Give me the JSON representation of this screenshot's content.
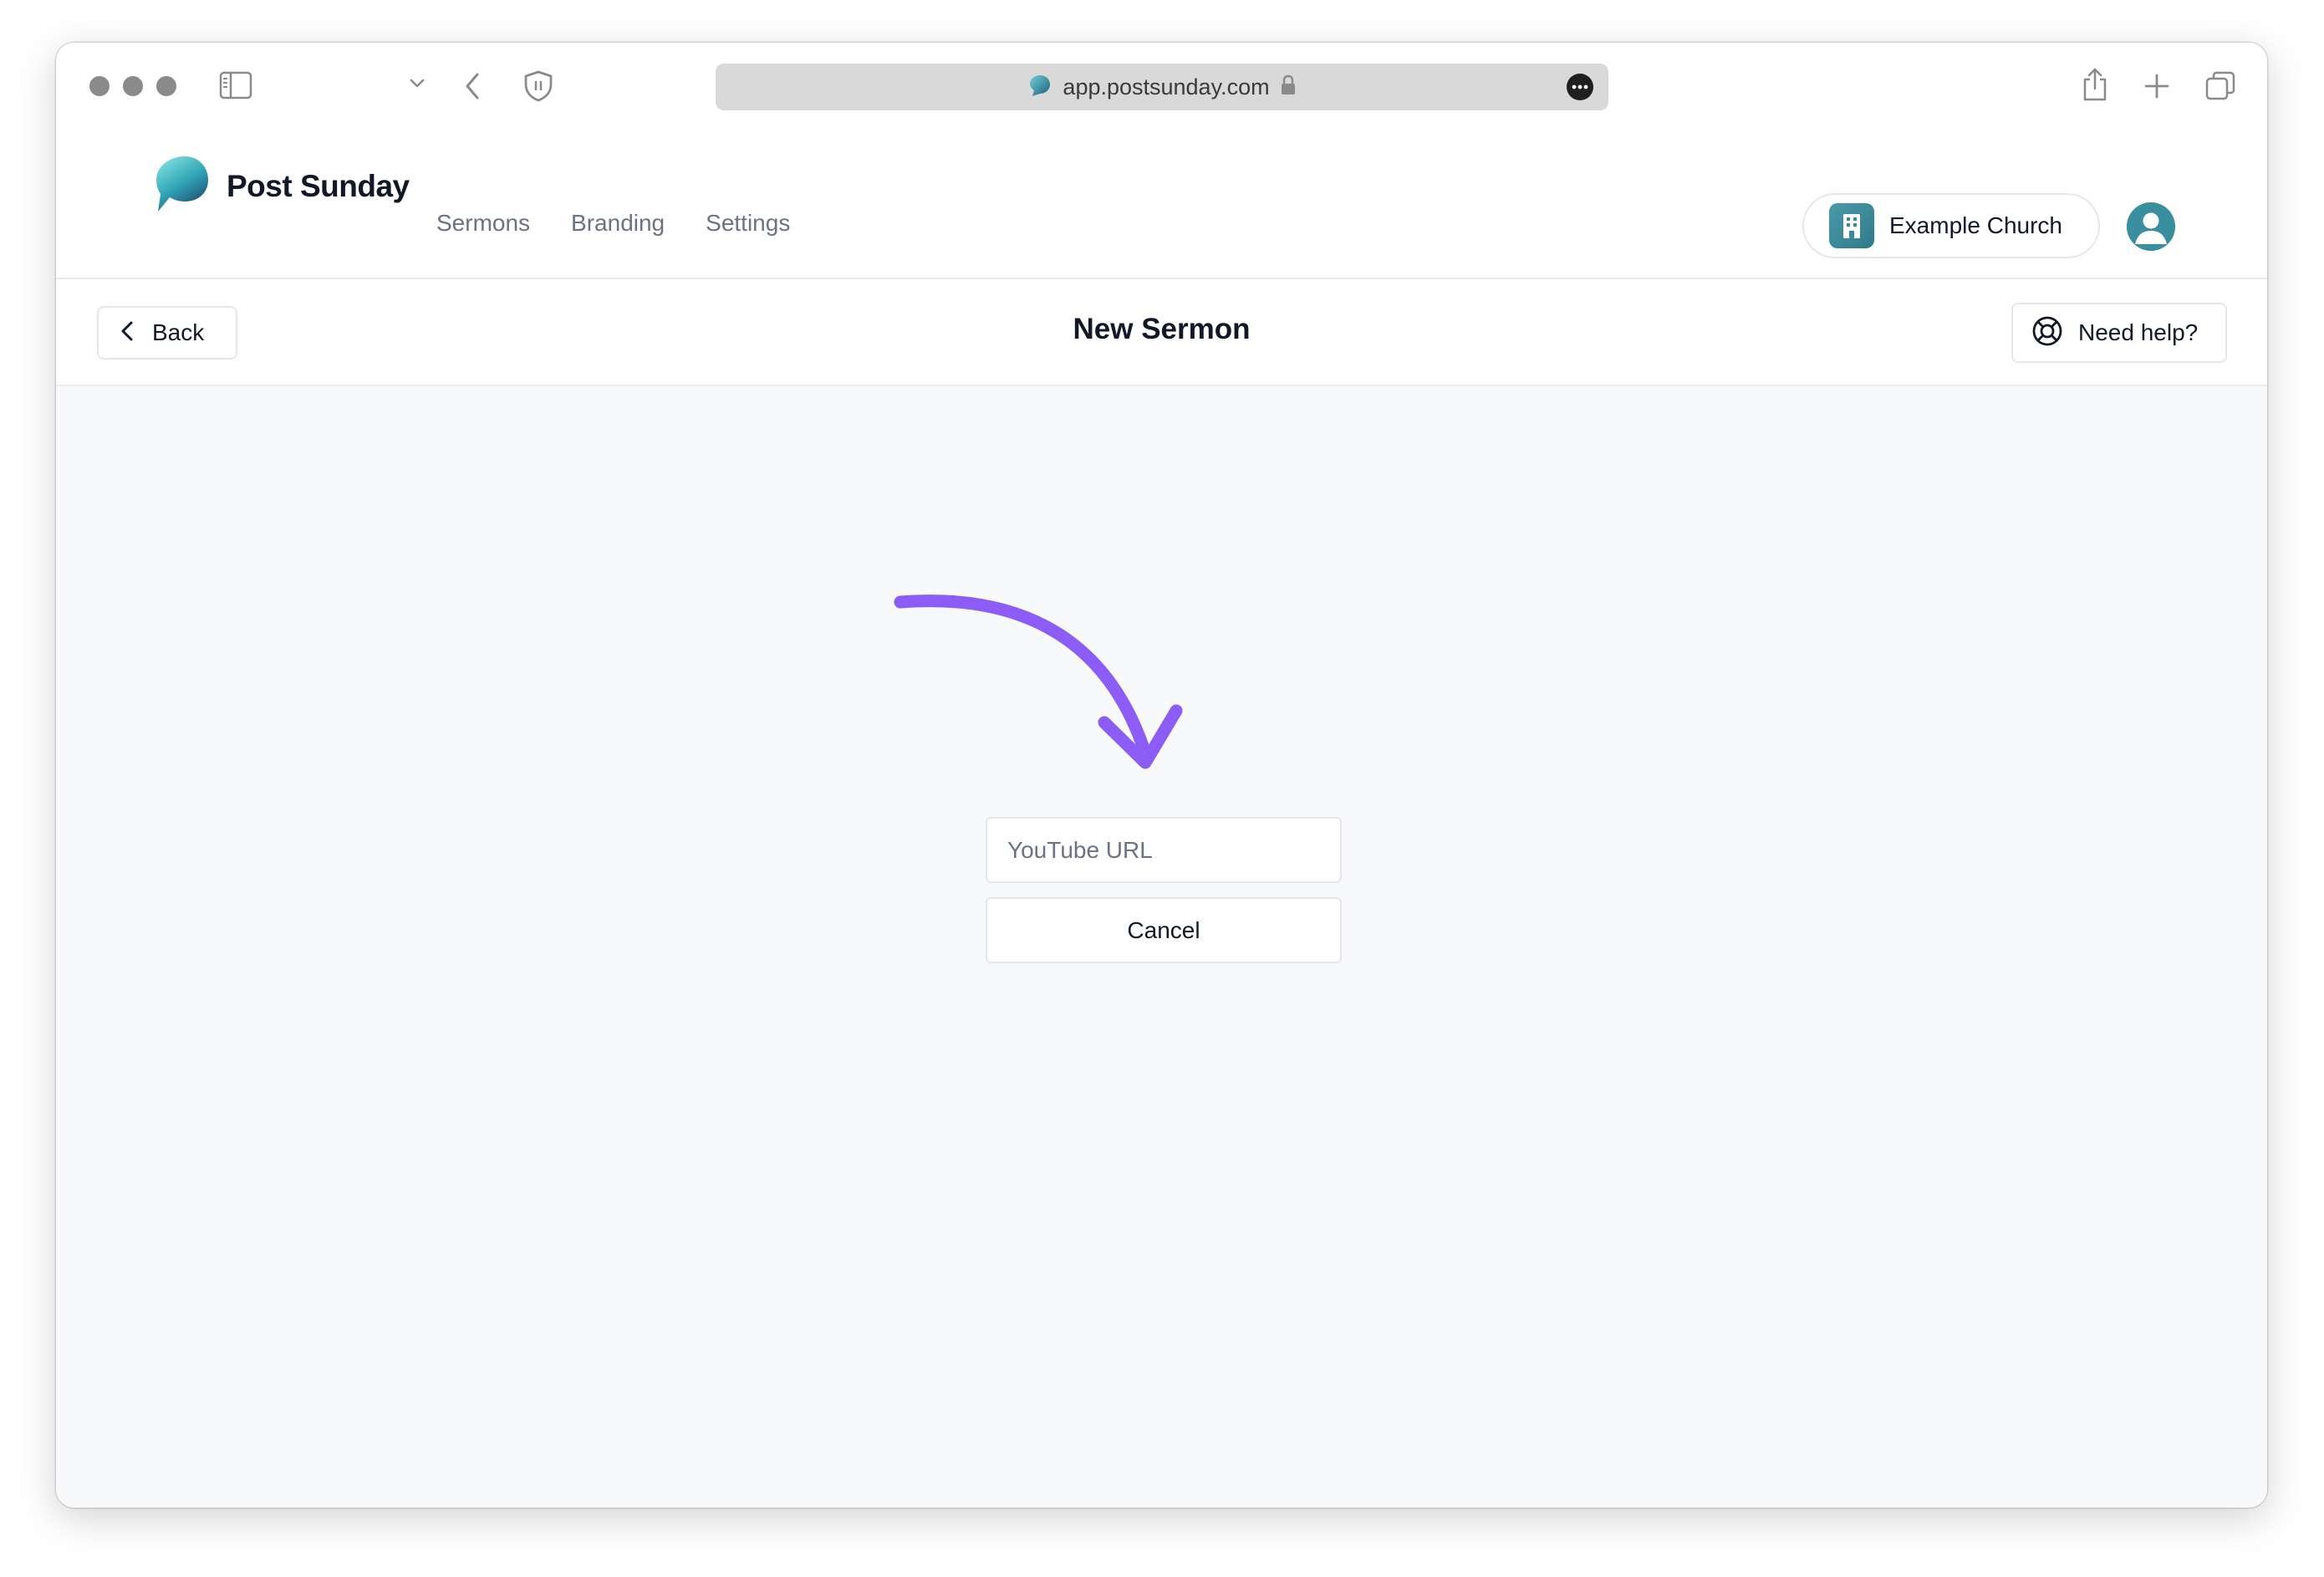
{
  "browser": {
    "url": "app.postsunday.com"
  },
  "app": {
    "brand_name": "Post Sunday",
    "nav": [
      {
        "label": "Sermons"
      },
      {
        "label": "Branding"
      },
      {
        "label": "Settings"
      }
    ],
    "church_name": "Example Church"
  },
  "header": {
    "back_label": "Back",
    "title": "New Sermon",
    "help_label": "Need help?"
  },
  "form": {
    "youtube_placeholder": "YouTube URL",
    "youtube_value": "",
    "cancel_label": "Cancel"
  },
  "colors": {
    "accent_arrow": "#8b5cf6",
    "brand_teal": "#2f8a9c",
    "background": "#f8f9fb"
  },
  "icons": [
    "sidebar-icon",
    "chevron-down-icon",
    "back-arrow-icon",
    "shield-icon",
    "site-favicon",
    "lock-icon",
    "more-icon",
    "share-icon",
    "new-tab-icon",
    "tabs-overview-icon",
    "logo-icon",
    "building-icon",
    "user-avatar-icon",
    "chevron-left-icon",
    "lifebuoy-icon",
    "curved-arrow-icon"
  ]
}
